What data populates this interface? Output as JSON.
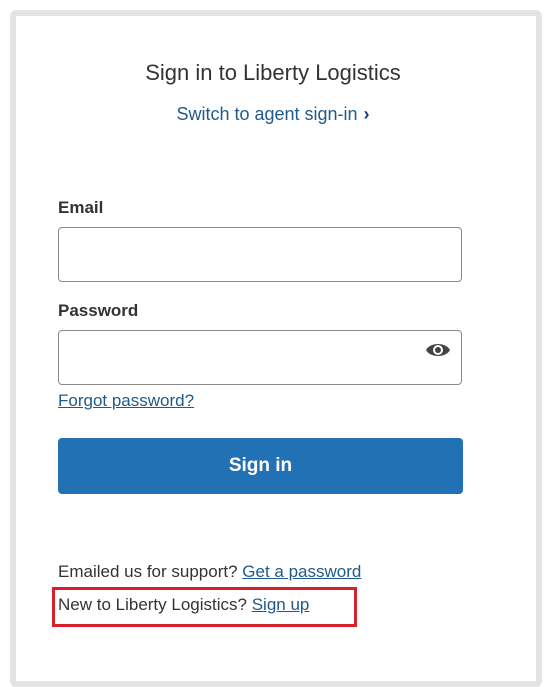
{
  "card": {
    "title": "Sign in to Liberty Logistics",
    "agent_link": "Switch to agent sign-in"
  },
  "form": {
    "email_label": "Email",
    "email_value": "",
    "password_label": "Password",
    "password_value": "",
    "show_password_icon": "eye-icon",
    "forgot_link": "Forgot password?",
    "submit_label": "Sign in"
  },
  "footer": {
    "support_text": "Emailed us for support?",
    "support_link": "Get a password",
    "signup_text": "New to Liberty Logistics?",
    "signup_link": "Sign up"
  },
  "colors": {
    "primary_button": "#2271b5",
    "link": "#1f5a8a",
    "highlight": "#d8202a",
    "frame_border": "#e4e4e4"
  }
}
